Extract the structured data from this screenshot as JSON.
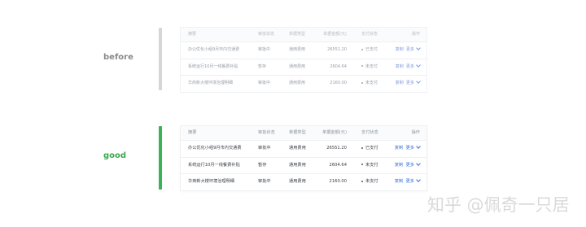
{
  "before": {
    "label": "before",
    "headers": {
      "summary": "摘要",
      "status": "审批状态",
      "type": "单据类型",
      "amount": "单据金额(元)",
      "pay": "支付状态",
      "ops": "操作"
    },
    "rows": [
      {
        "summary": "办公优化小组9月市内交通费",
        "status": "审批中",
        "type": "通用费用",
        "amount": "26551.20",
        "pay": "已支付",
        "copy": "复制",
        "more": "更多"
      },
      {
        "summary": "系统运行10月一线餐费补贴",
        "status": "暂存",
        "type": "通用费用",
        "amount": "2604.64",
        "pay": "未支付",
        "copy": "复制",
        "more": "更多"
      },
      {
        "summary": "华商新大楼环境治理明细",
        "status": "审批中",
        "type": "通用费用",
        "amount": "2160.00",
        "pay": "未支付",
        "copy": "复制",
        "more": "更多"
      }
    ]
  },
  "good": {
    "label": "good",
    "headers": {
      "summary": "摘要",
      "status": "审批状态",
      "type": "单据类型",
      "amount": "单据金额(元)",
      "pay": "支付状态",
      "ops": "操作"
    },
    "rows": [
      {
        "summary": "办公优化小组9月市内交通费",
        "status": "审批中",
        "type": "通用费用",
        "amount": "26551.20",
        "pay": "已支付",
        "copy": "复制",
        "more": "更多"
      },
      {
        "summary": "系统运行10月一线餐费补贴",
        "status": "暂存",
        "type": "通用费用",
        "amount": "2604.64",
        "pay": "未支付",
        "copy": "复制",
        "more": "更多"
      },
      {
        "summary": "华商新大楼环境治理明细",
        "status": "审批中",
        "type": "通用费用",
        "amount": "2160.00",
        "pay": "未支付",
        "copy": "复制",
        "more": "更多"
      }
    ]
  },
  "watermark": "知乎 @佩奇一只居",
  "colors": {
    "good_accent": "#3ab358",
    "before_accent": "#d6d6d6",
    "link": "#3b6fd6"
  }
}
